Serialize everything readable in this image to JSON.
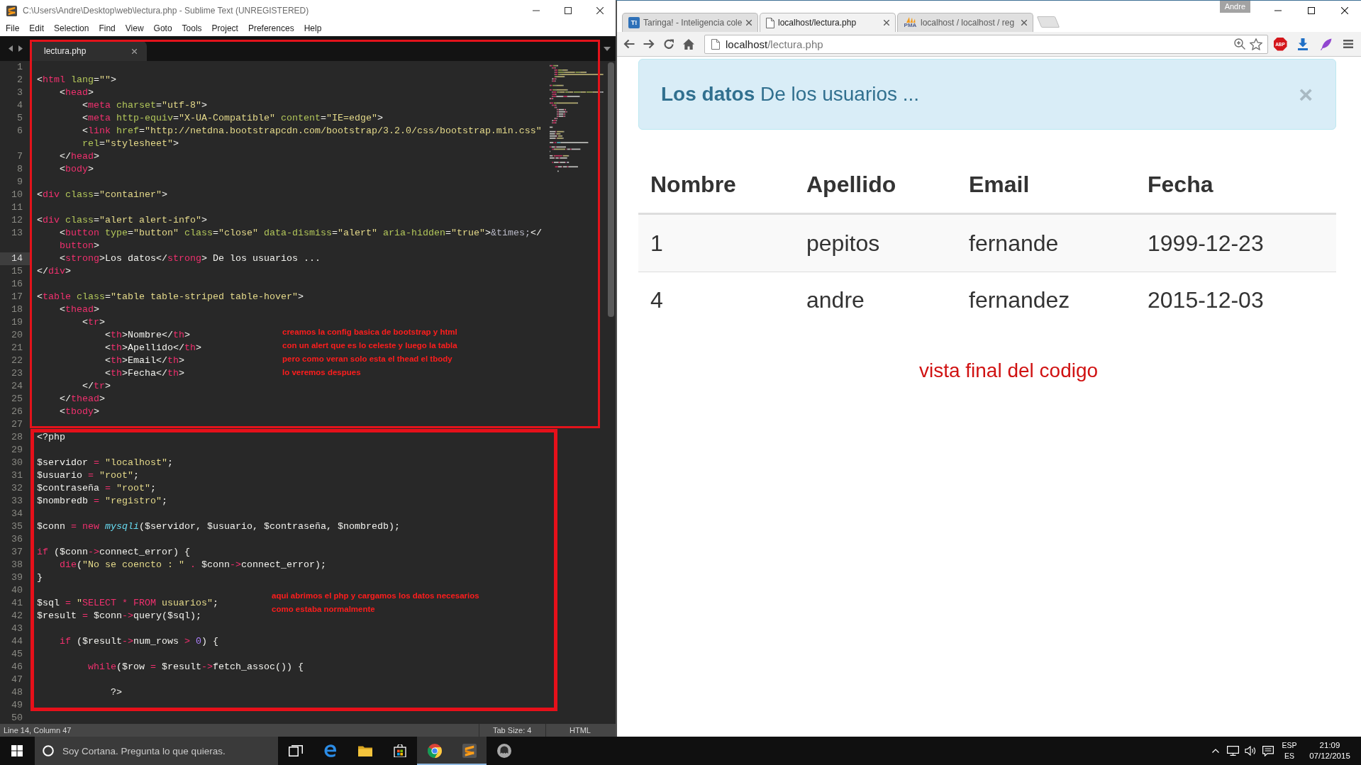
{
  "editor": {
    "title": "C:\\Users\\Andre\\Desktop\\web\\lectura.php - Sublime Text (UNREGISTERED)",
    "menu": [
      "File",
      "Edit",
      "Selection",
      "Find",
      "View",
      "Goto",
      "Tools",
      "Project",
      "Preferences",
      "Help"
    ],
    "tabs": [
      {
        "label": "lectura.php",
        "selected": true
      }
    ],
    "lines": [
      {
        "number": "1",
        "current": false
      },
      {
        "number": "2",
        "current": false,
        "tokens": [
          {
            "kind": "plain",
            "text": "<"
          },
          {
            "kind": "tag",
            "text": "html"
          },
          {
            "kind": "attr",
            "text": " lang"
          },
          {
            "kind": "plain",
            "text": "="
          },
          {
            "kind": "string",
            "text": "\"\""
          },
          {
            "kind": "plain",
            "text": ">"
          }
        ]
      },
      {
        "number": "3",
        "current": false,
        "tokens": [
          {
            "kind": "plain",
            "text": "    <"
          },
          {
            "kind": "tag",
            "text": "head"
          },
          {
            "kind": "plain",
            "text": ">"
          }
        ]
      },
      {
        "number": "4",
        "current": false,
        "tokens": [
          {
            "kind": "plain",
            "text": "        <"
          },
          {
            "kind": "tag",
            "text": "meta"
          },
          {
            "kind": "attr",
            "text": " charset"
          },
          {
            "kind": "plain",
            "text": "="
          },
          {
            "kind": "string",
            "text": "\"utf-8\""
          },
          {
            "kind": "plain",
            "text": ">"
          }
        ]
      },
      {
        "number": "5",
        "current": false,
        "tokens": [
          {
            "kind": "plain",
            "text": "        <"
          },
          {
            "kind": "tag",
            "text": "meta"
          },
          {
            "kind": "attr",
            "text": " http-equiv"
          },
          {
            "kind": "plain",
            "text": "="
          },
          {
            "kind": "string",
            "text": "\"X-UA-Compatible\""
          },
          {
            "kind": "attr",
            "text": " content"
          },
          {
            "kind": "plain",
            "text": "="
          },
          {
            "kind": "string",
            "text": "\"IE=edge\""
          },
          {
            "kind": "plain",
            "text": ">"
          }
        ]
      },
      {
        "number": "6",
        "current": false,
        "tokens": [
          {
            "kind": "plain",
            "text": "        <"
          },
          {
            "kind": "tag",
            "text": "link"
          },
          {
            "kind": "attr",
            "text": " href"
          },
          {
            "kind": "plain",
            "text": "="
          },
          {
            "kind": "string",
            "text": "\"http://netdna.bootstrapcdn.com/bootstrap/3.2.0/css/bootstrap.min.css\""
          }
        ],
        "wrap": [
          {
            "kind": "attr",
            "text": "        rel"
          },
          {
            "kind": "plain",
            "text": "="
          },
          {
            "kind": "string",
            "text": "\"stylesheet\""
          },
          {
            "kind": "plain",
            "text": ">"
          }
        ]
      },
      {
        "number": "7",
        "current": false,
        "tokens": [
          {
            "kind": "plain",
            "text": "    </"
          },
          {
            "kind": "tag",
            "text": "head"
          },
          {
            "kind": "plain",
            "text": ">"
          }
        ]
      },
      {
        "number": "8",
        "current": false,
        "tokens": [
          {
            "kind": "plain",
            "text": "    <"
          },
          {
            "kind": "tag",
            "text": "body"
          },
          {
            "kind": "plain",
            "text": ">"
          }
        ]
      },
      {
        "number": "9",
        "current": false
      },
      {
        "number": "10",
        "current": false,
        "tokens": [
          {
            "kind": "plain",
            "text": "<"
          },
          {
            "kind": "tag",
            "text": "div"
          },
          {
            "kind": "attr",
            "text": " class"
          },
          {
            "kind": "plain",
            "text": "="
          },
          {
            "kind": "string",
            "text": "\"container\""
          },
          {
            "kind": "plain",
            "text": ">"
          }
        ]
      },
      {
        "number": "11",
        "current": false
      },
      {
        "number": "12",
        "current": false,
        "tokens": [
          {
            "kind": "plain",
            "text": "<"
          },
          {
            "kind": "tag",
            "text": "div"
          },
          {
            "kind": "attr",
            "text": " class"
          },
          {
            "kind": "plain",
            "text": "="
          },
          {
            "kind": "string",
            "text": "\"alert alert-info\""
          },
          {
            "kind": "plain",
            "text": ">"
          }
        ]
      },
      {
        "number": "13",
        "current": false,
        "tokens": [
          {
            "kind": "plain",
            "text": "    <"
          },
          {
            "kind": "tag",
            "text": "button"
          },
          {
            "kind": "attr",
            "text": " type"
          },
          {
            "kind": "plain",
            "text": "="
          },
          {
            "kind": "string",
            "text": "\"button\""
          },
          {
            "kind": "attr",
            "text": " class"
          },
          {
            "kind": "plain",
            "text": "="
          },
          {
            "kind": "string",
            "text": "\"close\""
          },
          {
            "kind": "attr",
            "text": " data-dismiss"
          },
          {
            "kind": "plain",
            "text": "="
          },
          {
            "kind": "string",
            "text": "\"alert\""
          },
          {
            "kind": "attr",
            "text": " aria-hidden"
          },
          {
            "kind": "plain",
            "text": "="
          },
          {
            "kind": "string",
            "text": "\"true\""
          },
          {
            "kind": "plain",
            "text": ">"
          },
          {
            "kind": "entity",
            "text": "&times;"
          },
          {
            "kind": "plain",
            "text": "</"
          }
        ],
        "wrap": [
          {
            "kind": "tag",
            "text": "    button"
          },
          {
            "kind": "plain",
            "text": ">"
          }
        ]
      },
      {
        "number": "14",
        "current": true,
        "tokens": [
          {
            "kind": "plain",
            "text": "    <"
          },
          {
            "kind": "tag",
            "text": "strong"
          },
          {
            "kind": "plain",
            "text": ">Los datos</"
          },
          {
            "kind": "tag",
            "text": "strong"
          },
          {
            "kind": "plain",
            "text": "> De los usuarios ..."
          }
        ]
      },
      {
        "number": "15",
        "current": false,
        "tokens": [
          {
            "kind": "plain",
            "text": "</"
          },
          {
            "kind": "tag",
            "text": "div"
          },
          {
            "kind": "plain",
            "text": ">"
          }
        ]
      },
      {
        "number": "16",
        "current": false
      },
      {
        "number": "17",
        "current": false,
        "tokens": [
          {
            "kind": "plain",
            "text": "<"
          },
          {
            "kind": "tag",
            "text": "table"
          },
          {
            "kind": "attr",
            "text": " class"
          },
          {
            "kind": "plain",
            "text": "="
          },
          {
            "kind": "string",
            "text": "\"table table-striped table-hover\""
          },
          {
            "kind": "plain",
            "text": ">"
          }
        ]
      },
      {
        "number": "18",
        "current": false,
        "tokens": [
          {
            "kind": "plain",
            "text": "    <"
          },
          {
            "kind": "tag",
            "text": "thead"
          },
          {
            "kind": "plain",
            "text": ">"
          }
        ]
      },
      {
        "number": "19",
        "current": false,
        "tokens": [
          {
            "kind": "plain",
            "text": "        <"
          },
          {
            "kind": "tag",
            "text": "tr"
          },
          {
            "kind": "plain",
            "text": ">"
          }
        ]
      },
      {
        "number": "20",
        "current": false,
        "tokens": [
          {
            "kind": "plain",
            "text": "            <"
          },
          {
            "kind": "tag",
            "text": "th"
          },
          {
            "kind": "plain",
            "text": ">Nombre</"
          },
          {
            "kind": "tag",
            "text": "th"
          },
          {
            "kind": "plain",
            "text": ">"
          }
        ]
      },
      {
        "number": "21",
        "current": false,
        "tokens": [
          {
            "kind": "plain",
            "text": "            <"
          },
          {
            "kind": "tag",
            "text": "th"
          },
          {
            "kind": "plain",
            "text": ">Apellido</"
          },
          {
            "kind": "tag",
            "text": "th"
          },
          {
            "kind": "plain",
            "text": ">"
          }
        ]
      },
      {
        "number": "22",
        "current": false,
        "tokens": [
          {
            "kind": "plain",
            "text": "            <"
          },
          {
            "kind": "tag",
            "text": "th"
          },
          {
            "kind": "plain",
            "text": ">Email</"
          },
          {
            "kind": "tag",
            "text": "th"
          },
          {
            "kind": "plain",
            "text": ">"
          }
        ]
      },
      {
        "number": "23",
        "current": false,
        "tokens": [
          {
            "kind": "plain",
            "text": "            <"
          },
          {
            "kind": "tag",
            "text": "th"
          },
          {
            "kind": "plain",
            "text": ">Fecha</"
          },
          {
            "kind": "tag",
            "text": "th"
          },
          {
            "kind": "plain",
            "text": ">"
          }
        ]
      },
      {
        "number": "24",
        "current": false,
        "tokens": [
          {
            "kind": "plain",
            "text": "        </"
          },
          {
            "kind": "tag",
            "text": "tr"
          },
          {
            "kind": "plain",
            "text": ">"
          }
        ]
      },
      {
        "number": "25",
        "current": false,
        "tokens": [
          {
            "kind": "plain",
            "text": "    </"
          },
          {
            "kind": "tag",
            "text": "thead"
          },
          {
            "kind": "plain",
            "text": ">"
          }
        ]
      },
      {
        "number": "26",
        "current": false,
        "tokens": [
          {
            "kind": "plain",
            "text": "    <"
          },
          {
            "kind": "tag",
            "text": "tbody"
          },
          {
            "kind": "plain",
            "text": ">"
          }
        ]
      },
      {
        "number": "27",
        "current": false
      },
      {
        "number": "28",
        "current": false,
        "tokens": [
          {
            "kind": "plain",
            "text": "<?php"
          }
        ]
      },
      {
        "number": "29",
        "current": false
      },
      {
        "number": "30",
        "current": false,
        "tokens": [
          {
            "kind": "plain",
            "text": "$servidor "
          },
          {
            "kind": "operator",
            "text": "="
          },
          {
            "kind": "string",
            "text": " \"localhost\""
          },
          {
            "kind": "plain",
            "text": ";"
          }
        ]
      },
      {
        "number": "31",
        "current": false,
        "tokens": [
          {
            "kind": "plain",
            "text": "$usuario "
          },
          {
            "kind": "operator",
            "text": "="
          },
          {
            "kind": "string",
            "text": " \"root\""
          },
          {
            "kind": "plain",
            "text": ";"
          }
        ]
      },
      {
        "number": "32",
        "current": false,
        "tokens": [
          {
            "kind": "plain",
            "text": "$contraseña "
          },
          {
            "kind": "operator",
            "text": "="
          },
          {
            "kind": "string",
            "text": " \"root\""
          },
          {
            "kind": "plain",
            "text": ";"
          }
        ]
      },
      {
        "number": "33",
        "current": false,
        "tokens": [
          {
            "kind": "plain",
            "text": "$nombredb "
          },
          {
            "kind": "operator",
            "text": "="
          },
          {
            "kind": "string",
            "text": " \"registro\""
          },
          {
            "kind": "plain",
            "text": ";"
          }
        ]
      },
      {
        "number": "34",
        "current": false
      },
      {
        "number": "35",
        "current": false,
        "tokens": [
          {
            "kind": "plain",
            "text": "$conn "
          },
          {
            "kind": "operator",
            "text": "="
          },
          {
            "kind": "keyword",
            "text": " new"
          },
          {
            "kind": "function",
            "text": " mysqli"
          },
          {
            "kind": "plain",
            "text": "($servidor, $usuario, $contraseña, $nombredb);"
          }
        ]
      },
      {
        "number": "36",
        "current": false
      },
      {
        "number": "37",
        "current": false,
        "tokens": [
          {
            "kind": "keyword",
            "text": "if"
          },
          {
            "kind": "plain",
            "text": " ($conn"
          },
          {
            "kind": "operator",
            "text": "->"
          },
          {
            "kind": "plain",
            "text": "connect_error) {"
          }
        ]
      },
      {
        "number": "38",
        "current": false,
        "tokens": [
          {
            "kind": "keyword",
            "text": "    die"
          },
          {
            "kind": "plain",
            "text": "("
          },
          {
            "kind": "string",
            "text": "\"No se coencto : \""
          },
          {
            "kind": "operator",
            "text": " ."
          },
          {
            "kind": "plain",
            "text": " $conn"
          },
          {
            "kind": "operator",
            "text": "->"
          },
          {
            "kind": "plain",
            "text": "connect_error);"
          }
        ]
      },
      {
        "number": "39",
        "current": false,
        "tokens": [
          {
            "kind": "plain",
            "text": "}"
          }
        ]
      },
      {
        "number": "40",
        "current": false
      },
      {
        "number": "41",
        "current": false,
        "tokens": [
          {
            "kind": "plain",
            "text": "$sql "
          },
          {
            "kind": "operator",
            "text": "="
          },
          {
            "kind": "string",
            "text": " \""
          },
          {
            "kind": "keyword",
            "text": "SELECT * FROM"
          },
          {
            "kind": "string",
            "text": " usuarios\""
          },
          {
            "kind": "plain",
            "text": ";"
          }
        ]
      },
      {
        "number": "42",
        "current": false,
        "tokens": [
          {
            "kind": "plain",
            "text": "$result "
          },
          {
            "kind": "operator",
            "text": "="
          },
          {
            "kind": "plain",
            "text": " $conn"
          },
          {
            "kind": "operator",
            "text": "->"
          },
          {
            "kind": "plain",
            "text": "query($sql);"
          }
        ]
      },
      {
        "number": "43",
        "current": false
      },
      {
        "number": "44",
        "current": false,
        "tokens": [
          {
            "kind": "keyword",
            "text": "    if"
          },
          {
            "kind": "plain",
            "text": " ($result"
          },
          {
            "kind": "operator",
            "text": "->"
          },
          {
            "kind": "plain",
            "text": "num_rows "
          },
          {
            "kind": "operator",
            "text": ">"
          },
          {
            "kind": "number",
            "text": " 0"
          },
          {
            "kind": "plain",
            "text": ") {"
          }
        ]
      },
      {
        "number": "45",
        "current": false
      },
      {
        "number": "46",
        "current": false,
        "tokens": [
          {
            "kind": "keyword",
            "text": "         while"
          },
          {
            "kind": "plain",
            "text": "($row "
          },
          {
            "kind": "operator",
            "text": "="
          },
          {
            "kind": "plain",
            "text": " $result"
          },
          {
            "kind": "operator",
            "text": "->"
          },
          {
            "kind": "plain",
            "text": "fetch_assoc()) {"
          }
        ]
      },
      {
        "number": "47",
        "current": false
      },
      {
        "number": "48",
        "current": false,
        "tokens": [
          {
            "kind": "plain",
            "text": "             ?>"
          }
        ]
      },
      {
        "number": "49",
        "current": false
      },
      {
        "number": "50",
        "current": false
      }
    ],
    "annotations": [
      {
        "lines": [
          "creamos la config basica de bootstrap y html",
          "con un alert que es lo celeste y luego la tabla",
          "pero como veran solo esta el thead el tbody",
          "lo veremos despues"
        ]
      },
      {
        "lines": [
          "aqui abrimos el php y cargamos los datos necesarios",
          "como estaba normalmente"
        ]
      }
    ],
    "status_bar": {
      "position": "Line 14, Column 47",
      "tab_size": "Tab Size: 4",
      "syntax": "HTML"
    }
  },
  "browser": {
    "profile": "Andre",
    "tabs": [
      {
        "favicon": {
          "kind": "lettered",
          "text": "T!"
        },
        "title": "Taringa! - Inteligencia cole",
        "selected": false
      },
      {
        "favicon": {
          "kind": "page"
        },
        "title": "localhost/lectura.php",
        "selected": true
      },
      {
        "favicon": {
          "kind": "sails",
          "text": "PMA"
        },
        "title": "localhost / localhost / reg",
        "selected": false
      }
    ],
    "address": {
      "host": "localhost",
      "path": "/lectura.php"
    },
    "extensions": [
      {
        "kind": "badge",
        "text": "ABP"
      },
      {
        "kind": "download"
      },
      {
        "kind": "feather"
      }
    ],
    "page": {
      "alert": {
        "text": "**Los datos** De los usuarios ...",
        "close": "×"
      },
      "table": {
        "columns": [
          "Nombre",
          "Apellido",
          "Email",
          "Fecha"
        ],
        "rows": [
          [
            "1",
            "pepitos",
            "fernande",
            "1999-12-23"
          ],
          [
            "4",
            "andre",
            "fernandez",
            "2015-12-03"
          ]
        ]
      },
      "note": "vista final del codigo"
    }
  },
  "taskbar": {
    "search": {
      "placeholder": "Soy Cortana. Pregunta lo que quieras."
    },
    "apps": [
      {
        "kind": "taskview",
        "active": false
      },
      {
        "kind": "edge",
        "active": false
      },
      {
        "kind": "folder",
        "active": false
      },
      {
        "kind": "store",
        "active": false
      },
      {
        "kind": "chrome",
        "active": true
      },
      {
        "kind": "sublime",
        "active": true
      },
      {
        "kind": "disc",
        "active": false
      }
    ],
    "language": {
      "primary": "ESP",
      "secondary": "ES"
    },
    "time": "21:09",
    "date": "07/12/2015"
  }
}
